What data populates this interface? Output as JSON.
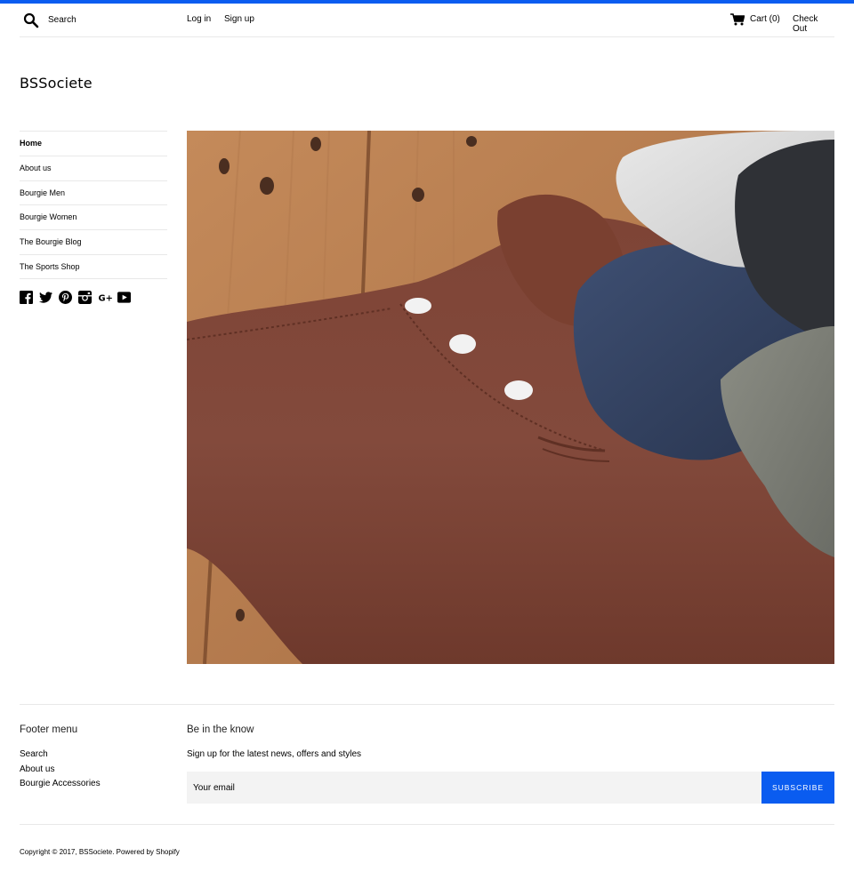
{
  "header": {
    "search_placeholder": "Search",
    "login_label": "Log in",
    "signup_label": "Sign up",
    "cart_label": "Cart (0)",
    "checkout_label": "Check Out",
    "accent_color": "#0a5cf0"
  },
  "site": {
    "logo": "BSSociete"
  },
  "sidebar": {
    "items": [
      {
        "label": "Home",
        "active": true
      },
      {
        "label": "About us"
      },
      {
        "label": "Bourgie Men"
      },
      {
        "label": "Bourgie Women"
      },
      {
        "label": "The Bourgie Blog"
      },
      {
        "label": "The Sports Shop"
      }
    ],
    "social_icons": [
      "facebook-icon",
      "twitter-icon",
      "pinterest-icon",
      "instagram-icon",
      "google-plus-icon",
      "youtube-icon"
    ]
  },
  "hero": {
    "image_subject": "folded henley t-shirts on wooden table"
  },
  "footer": {
    "menu_heading": "Footer menu",
    "menu_items": [
      "Search",
      "About us",
      "Bourgie Accessories"
    ],
    "newsletter_heading": "Be in the know",
    "newsletter_text": "Sign up for the latest news, offers and styles",
    "email_placeholder": "Your email",
    "subscribe_label": "SUBSCRIBE",
    "copyright_prefix": "Copyright © 2017, ",
    "copyright_store": "BSSociete",
    "copyright_sep": ". ",
    "powered_by": "Powered by Shopify"
  }
}
